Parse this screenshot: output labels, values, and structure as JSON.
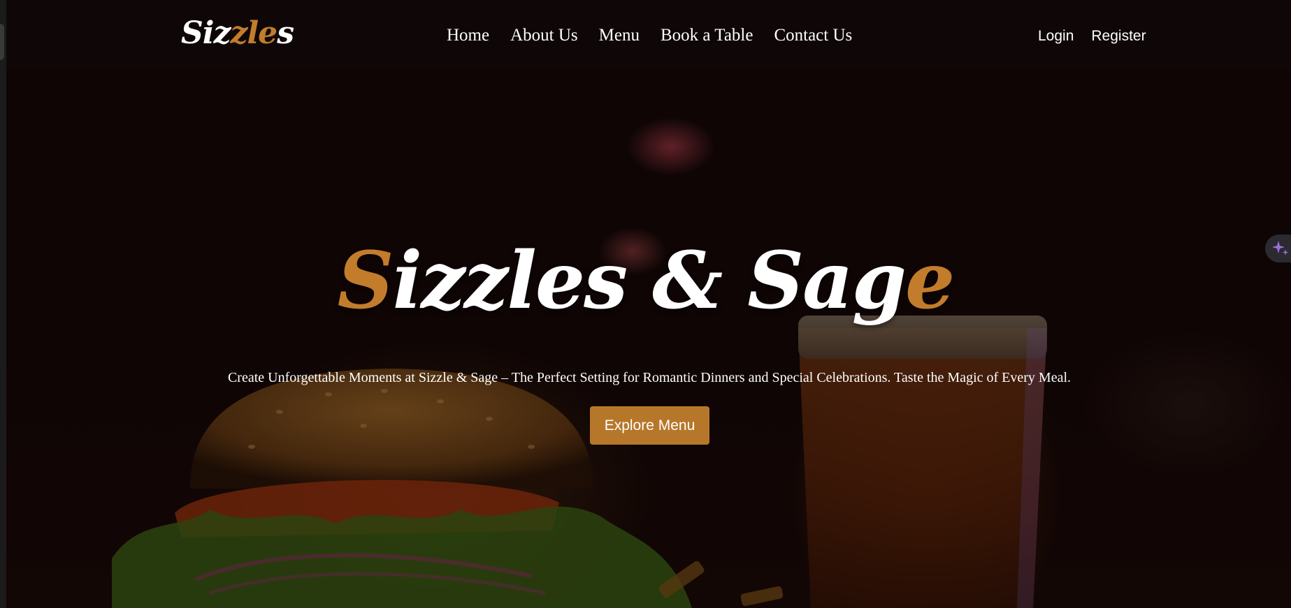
{
  "nav": {
    "logo": {
      "part1": "Siz",
      "part2": "zle",
      "part3": "s"
    },
    "links": [
      "Home",
      "About Us",
      "Menu",
      "Book a Table",
      "Contact Us"
    ],
    "auth": {
      "login": "Login",
      "register": "Register"
    }
  },
  "hero": {
    "title": {
      "first": "S",
      "middle": "izzles & Sag",
      "last": "e"
    },
    "subtitle": "Create Unforgettable Moments at Sizzle & Sage – The Perfect Setting for Romantic Dinners and Special Celebrations. Taste the Magic of Every Meal.",
    "cta_label": "Explore Menu"
  },
  "icons": {
    "assistant": "sparkle-icon"
  },
  "colors": {
    "accent": "#c27c2c",
    "button": "#b7772a",
    "background": "#120707",
    "text": "#ffffff"
  }
}
